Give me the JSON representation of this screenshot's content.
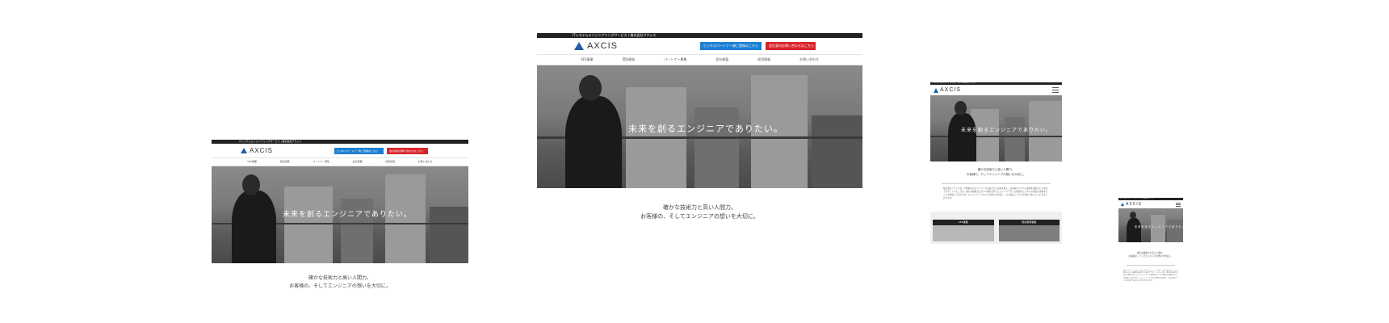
{
  "site": {
    "topbar_text": "ITシステムエンジニアリングサービス | 株式会社アクシス",
    "logo_text": "AXCIS",
    "btn_partner": "ビジネスパートナー様ご登録はこちら",
    "btn_recruit": "会社案内お問い合わせはこちら",
    "nav": [
      "SES事業",
      "受託開発",
      "パートナー募集",
      "会社概要",
      "採用情報",
      "お問い合わせ"
    ],
    "hero_text": "未来を創るエンジニアでありたい。",
    "tagline_1": "確かな技術力と高い人間力。",
    "tagline_2": "お客様の、そしてエンジニアの想いを大切に。",
    "body_text": "株式会社アクシスは、IT技術者のエンジニアが活躍できる環境を整え、お客様のシステム開発を技術力と人間力でサポートいたします。確かな技術力と高い人間力を持ったエンジニアが、お客様のビジネスの成長に貢献することを目指しております。エンジニア一人ひとりの想いを大切に、共に成長していける会社でありたいと考えております。",
    "card_ses": "SES事業",
    "card_dev": "受託開発事業"
  },
  "colors": {
    "accent_blue": "#1b7fd3",
    "accent_red": "#d7242a",
    "topbar": "#222222"
  }
}
